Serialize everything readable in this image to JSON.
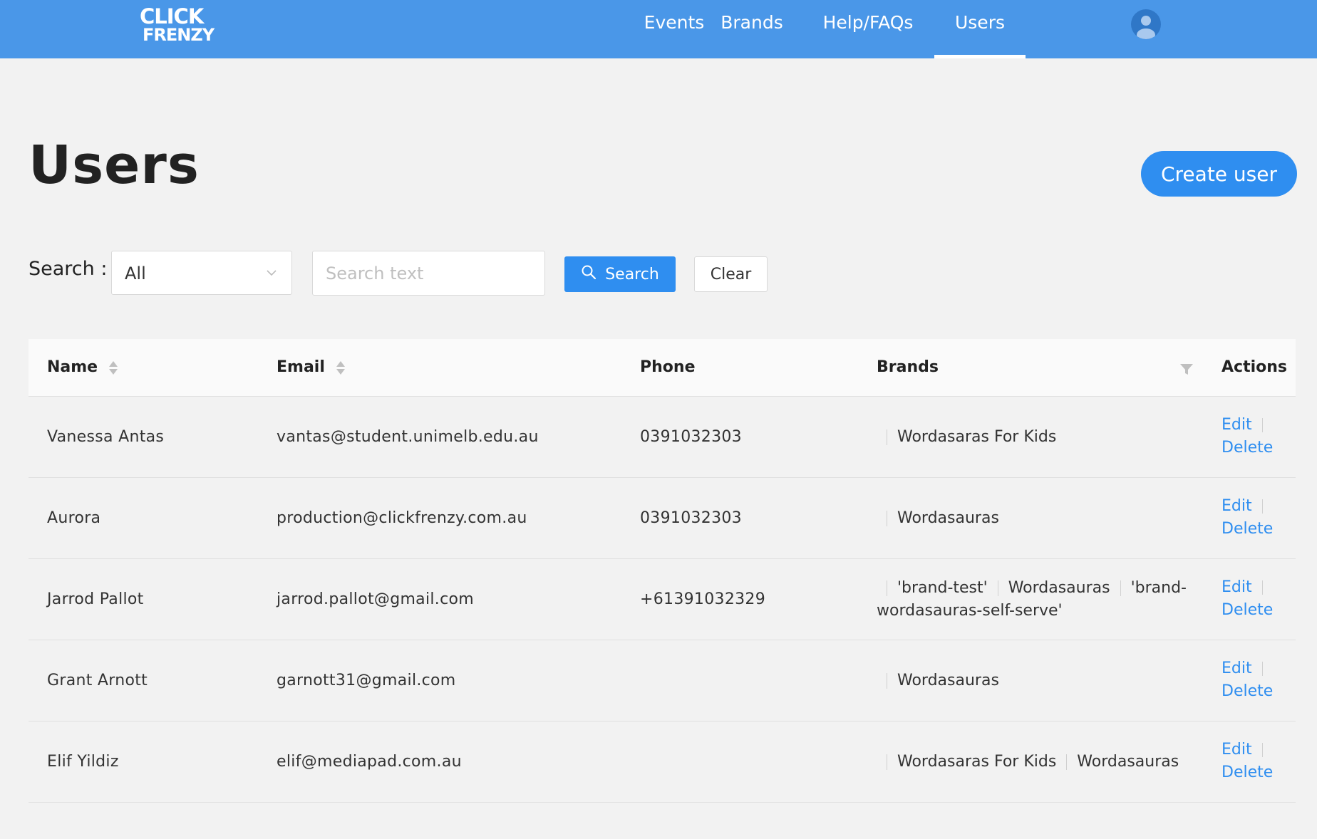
{
  "brand": {
    "logo_line1": "CLICK",
    "logo_line2": "FRENZY"
  },
  "nav": {
    "items": [
      {
        "label": "Events"
      },
      {
        "label": "Brands"
      },
      {
        "label": "Help/FAQs"
      },
      {
        "label": "Users",
        "active": true
      }
    ]
  },
  "page": {
    "title": "Users",
    "create_button": "Create user"
  },
  "search": {
    "label": "Search :",
    "field_selected": "All",
    "placeholder": "Search text",
    "search_button": "Search",
    "clear_button": "Clear"
  },
  "table": {
    "headers": {
      "name": "Name",
      "email": "Email",
      "phone": "Phone",
      "brands": "Brands",
      "actions": "Actions"
    },
    "action_labels": {
      "edit": "Edit",
      "delete": "Delete"
    },
    "rows": [
      {
        "name": "Vanessa Antas",
        "email": "vantas@student.unimelb.edu.au",
        "phone": "0391032303",
        "brands": [
          "Wordasaras For Kids"
        ]
      },
      {
        "name": "Aurora",
        "email": "production@clickfrenzy.com.au",
        "phone": "0391032303",
        "brands": [
          "Wordasauras"
        ]
      },
      {
        "name": "Jarrod Pallot",
        "email": "jarrod.pallot@gmail.com",
        "phone": "+61391032329",
        "brands": [
          "'brand-test'",
          "Wordasauras",
          "'brand-wordasauras-self-serve'"
        ]
      },
      {
        "name": "Grant Arnott",
        "email": "garnott31@gmail.com",
        "phone": "",
        "brands": [
          "Wordasauras"
        ]
      },
      {
        "name": "Elif Yildiz",
        "email": "elif@mediapad.com.au",
        "phone": "",
        "brands": [
          "Wordasaras For Kids",
          "Wordasauras"
        ]
      }
    ]
  },
  "colors": {
    "header_bg": "#4a97e8",
    "accent": "#2f8ef0",
    "page_bg": "#f2f2f2"
  },
  "icons": {
    "avatar": "user-avatar-icon",
    "select_arrow": "chevron-down-icon",
    "search": "search-icon",
    "sort": "sort-icon",
    "filter": "filter-icon"
  }
}
